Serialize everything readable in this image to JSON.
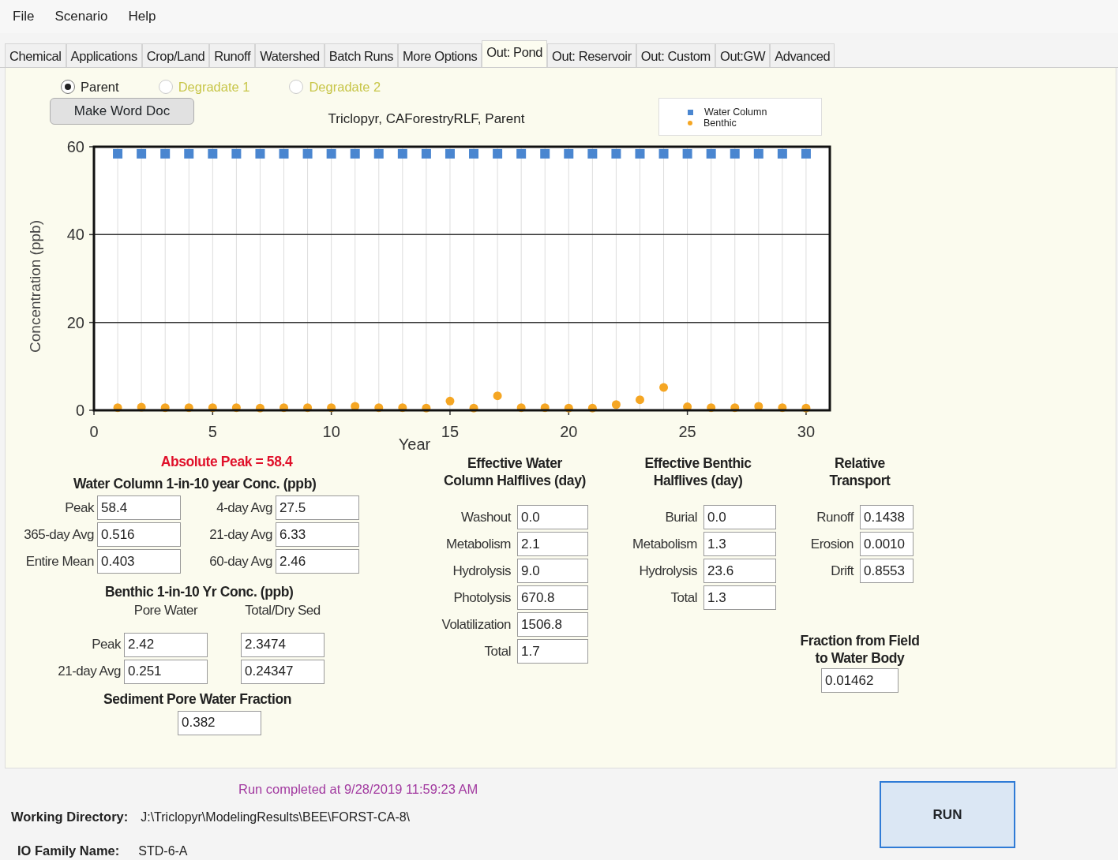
{
  "menu": [
    "File",
    "Scenario",
    "Help"
  ],
  "tabs": [
    {
      "label": "Chemical",
      "selected": false
    },
    {
      "label": "Applications",
      "selected": false
    },
    {
      "label": "Crop/Land",
      "selected": false
    },
    {
      "label": "Runoff",
      "selected": false
    },
    {
      "label": "Watershed",
      "selected": false
    },
    {
      "label": "Batch Runs",
      "selected": false
    },
    {
      "label": "More Options",
      "selected": false
    },
    {
      "label": "Out: Pond",
      "selected": true
    },
    {
      "label": "Out: Reservoir",
      "selected": false
    },
    {
      "label": "Out: Custom",
      "selected": false
    },
    {
      "label": "Out:GW",
      "selected": false
    },
    {
      "label": "Advanced",
      "selected": false
    }
  ],
  "species": [
    {
      "label": "Parent",
      "selected": true,
      "disabled": false
    },
    {
      "label": "Degradate 1",
      "selected": false,
      "disabled": true
    },
    {
      "label": "Degradate 2",
      "selected": false,
      "disabled": true
    }
  ],
  "make_doc_button": "Make Word Doc",
  "chart": {
    "chart_data": {
      "type": "scatter",
      "grid": true,
      "legend": true,
      "title": "Triclopyr, CAForestryRLF,  Parent",
      "xlabel": "Year",
      "ylabel": "Concentration (ppb)",
      "xlim": [
        0,
        31
      ],
      "ylim": [
        0,
        60
      ],
      "xticks": [
        0,
        5,
        10,
        15,
        20,
        25,
        30
      ],
      "yticks": [
        0,
        20,
        40,
        60
      ],
      "x": [
        1,
        2,
        3,
        4,
        5,
        6,
        7,
        8,
        9,
        10,
        11,
        12,
        13,
        14,
        15,
        16,
        17,
        18,
        19,
        20,
        21,
        22,
        23,
        24,
        25,
        26,
        27,
        28,
        29,
        30
      ],
      "series": [
        {
          "name": "Water Column",
          "color": "#4a86d0",
          "marker": "square",
          "values": [
            58.4,
            58.4,
            58.4,
            58.4,
            58.4,
            58.4,
            58.4,
            58.4,
            58.4,
            58.4,
            58.4,
            58.4,
            58.4,
            58.4,
            58.4,
            58.4,
            58.4,
            58.4,
            58.4,
            58.4,
            58.4,
            58.4,
            58.4,
            58.4,
            58.4,
            58.4,
            58.4,
            58.4,
            58.4,
            58.4
          ]
        },
        {
          "name": "Benthic",
          "color": "#f5a623",
          "marker": "circle",
          "values": [
            0.6,
            0.7,
            0.6,
            0.6,
            0.6,
            0.6,
            0.5,
            0.6,
            0.6,
            0.6,
            0.9,
            0.6,
            0.6,
            0.5,
            2.1,
            0.5,
            3.3,
            0.6,
            0.6,
            0.5,
            0.5,
            1.3,
            2.4,
            5.2,
            0.8,
            0.6,
            0.6,
            0.9,
            0.6,
            0.5
          ]
        }
      ]
    }
  },
  "absolute_peak": "Absolute Peak = 58.4",
  "water_column": {
    "title": "Water Column  1-in-10 year Conc. (ppb)",
    "fields": [
      {
        "label": "Peak",
        "value": "58.4"
      },
      {
        "label": "4-day Avg",
        "value": "27.5"
      },
      {
        "label": "365-day Avg",
        "value": "0.516"
      },
      {
        "label": "21-day Avg",
        "value": "6.33"
      },
      {
        "label": "Entire Mean",
        "value": "0.403"
      },
      {
        "label": "60-day Avg",
        "value": "2.46"
      }
    ]
  },
  "benthic": {
    "title": "Benthic  1-in-10 Yr Conc. (ppb)",
    "columns": [
      "Pore Water",
      "Total/Dry Sed"
    ],
    "rows": [
      {
        "label": "Peak",
        "values": [
          "2.42",
          "2.3474"
        ]
      },
      {
        "label": "21-day Avg",
        "values": [
          "0.251",
          "0.24347"
        ]
      }
    ]
  },
  "pore_fraction": {
    "title": "Sediment  Pore Water Fraction",
    "value": "0.382"
  },
  "water_halflives": {
    "title_lines": [
      "Effective Water",
      "Column Halflives (day)"
    ],
    "fields": [
      {
        "label": "Washout",
        "value": "0.0"
      },
      {
        "label": "Metabolism",
        "value": "2.1"
      },
      {
        "label": "Hydrolysis",
        "value": "9.0"
      },
      {
        "label": "Photolysis",
        "value": "670.8"
      },
      {
        "label": "Volatilization",
        "value": "1506.8"
      },
      {
        "label": "Total",
        "value": "1.7"
      }
    ]
  },
  "benthic_halflives": {
    "title_lines": [
      "Effective Benthic",
      "Halflives (day)"
    ],
    "fields": [
      {
        "label": "Burial",
        "value": "0.0"
      },
      {
        "label": "Metabolism",
        "value": "1.3"
      },
      {
        "label": "Hydrolysis",
        "value": "23.6"
      },
      {
        "label": "Total",
        "value": "1.3"
      }
    ]
  },
  "relative_transport": {
    "title_lines": [
      "Relative",
      "Transport"
    ],
    "fields": [
      {
        "label": "Runoff",
        "value": "0.1438"
      },
      {
        "label": "Erosion",
        "value": "0.0010"
      },
      {
        "label": "Drift",
        "value": "0.8553"
      }
    ]
  },
  "fraction_field": {
    "title_lines": [
      "Fraction from Field",
      "to Water Body"
    ],
    "value": "0.01462"
  },
  "status": "Run completed at 9/28/2019 11:59:23 AM",
  "working_directory": {
    "label": "Working Directory:",
    "value": "J:\\Triclopyr\\ModelingResults\\BEE\\FORST-CA-8\\"
  },
  "io_family": {
    "label": "IO Family Name:",
    "value": "STD-6-A"
  },
  "run_button": "RUN"
}
